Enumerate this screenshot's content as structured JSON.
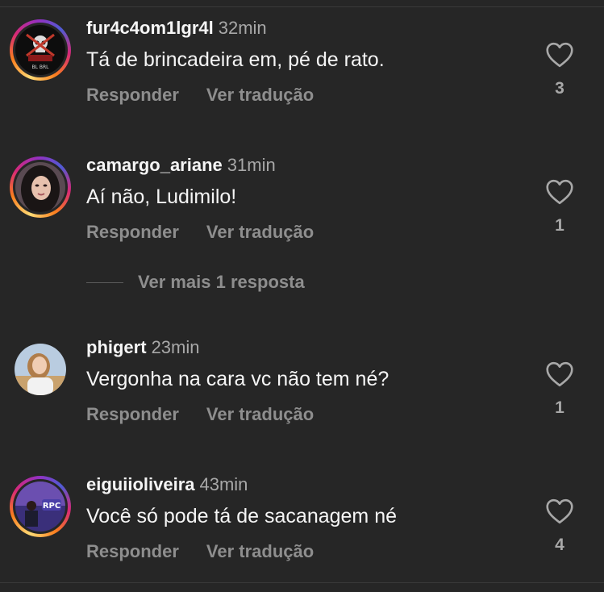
{
  "comments": [
    {
      "username": "fur4c4om1lgr4l",
      "time": "32min",
      "text": "Tá de brincadeira em, pé de rato.",
      "reply_label": "Responder",
      "translate_label": "Ver tradução",
      "likes": "3",
      "avatar_text": "BL BRL"
    },
    {
      "username": "camargo_ariane",
      "time": "31min",
      "text": "Aí não, Ludimilo!",
      "reply_label": "Responder",
      "translate_label": "Ver tradução",
      "likes": "1"
    },
    {
      "username": "phigert",
      "time": "23min",
      "text": "Vergonha na cara vc não tem né?",
      "reply_label": "Responder",
      "translate_label": "Ver tradução",
      "likes": "1"
    },
    {
      "username": "eiguiioliveira",
      "time": "43min",
      "text": "Você só pode tá de sacanagem né",
      "reply_label": "Responder",
      "translate_label": "Ver tradução",
      "likes": "4",
      "avatar_text": "RPC"
    }
  ],
  "more_replies": "Ver mais 1 resposta",
  "colors": {
    "background": "#262626",
    "primary_text": "#f5f5f5",
    "secondary_text": "#8e8e8e",
    "story_ring": [
      "#feda75",
      "#fa7e1e",
      "#d62976",
      "#962fbf"
    ]
  },
  "icons": {
    "like": "heart-outline-icon"
  }
}
